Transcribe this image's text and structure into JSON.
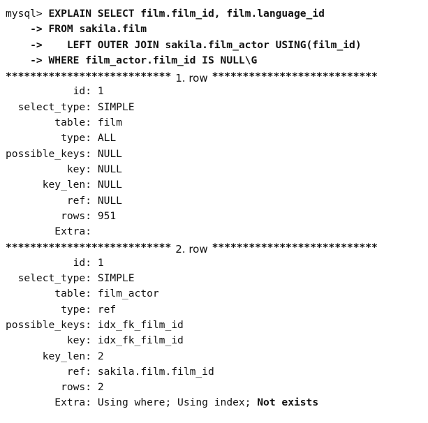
{
  "query": {
    "prompt": "mysql> ",
    "continuation": "    -> ",
    "lines": [
      "EXPLAIN SELECT film.film_id, film.language_id",
      "FROM sakila.film",
      "    LEFT OUTER JOIN sakila.film_actor USING(film_id)",
      "WHERE film_actor.film_id IS NULL\\G"
    ]
  },
  "separators": {
    "stars_left": "***************************",
    "stars_right": "***************************",
    "row1_label": "1. row",
    "row2_label": "2. row"
  },
  "rows": [
    {
      "fields": [
        {
          "key": "           id:",
          "value": "1"
        },
        {
          "key": "  select_type:",
          "value": "SIMPLE"
        },
        {
          "key": "        table:",
          "value": "film"
        },
        {
          "key": "         type:",
          "value": "ALL"
        },
        {
          "key": "possible_keys:",
          "value": "NULL"
        },
        {
          "key": "          key:",
          "value": "NULL"
        },
        {
          "key": "      key_len:",
          "value": "NULL"
        },
        {
          "key": "          ref:",
          "value": "NULL"
        },
        {
          "key": "         rows:",
          "value": "951"
        },
        {
          "key": "        Extra:",
          "value": ""
        }
      ]
    },
    {
      "fields": [
        {
          "key": "           id:",
          "value": "1"
        },
        {
          "key": "  select_type:",
          "value": "SIMPLE"
        },
        {
          "key": "        table:",
          "value": "film_actor"
        },
        {
          "key": "         type:",
          "value": "ref"
        },
        {
          "key": "possible_keys:",
          "value": "idx_fk_film_id"
        },
        {
          "key": "          key:",
          "value": "idx_fk_film_id"
        },
        {
          "key": "      key_len:",
          "value": "2"
        },
        {
          "key": "          ref:",
          "value": "sakila.film.film_id"
        },
        {
          "key": "         rows:",
          "value": "2"
        },
        {
          "key": "        Extra:",
          "value": "Using where; Using index; "
        }
      ],
      "extra_bold": "Not exists"
    }
  ]
}
